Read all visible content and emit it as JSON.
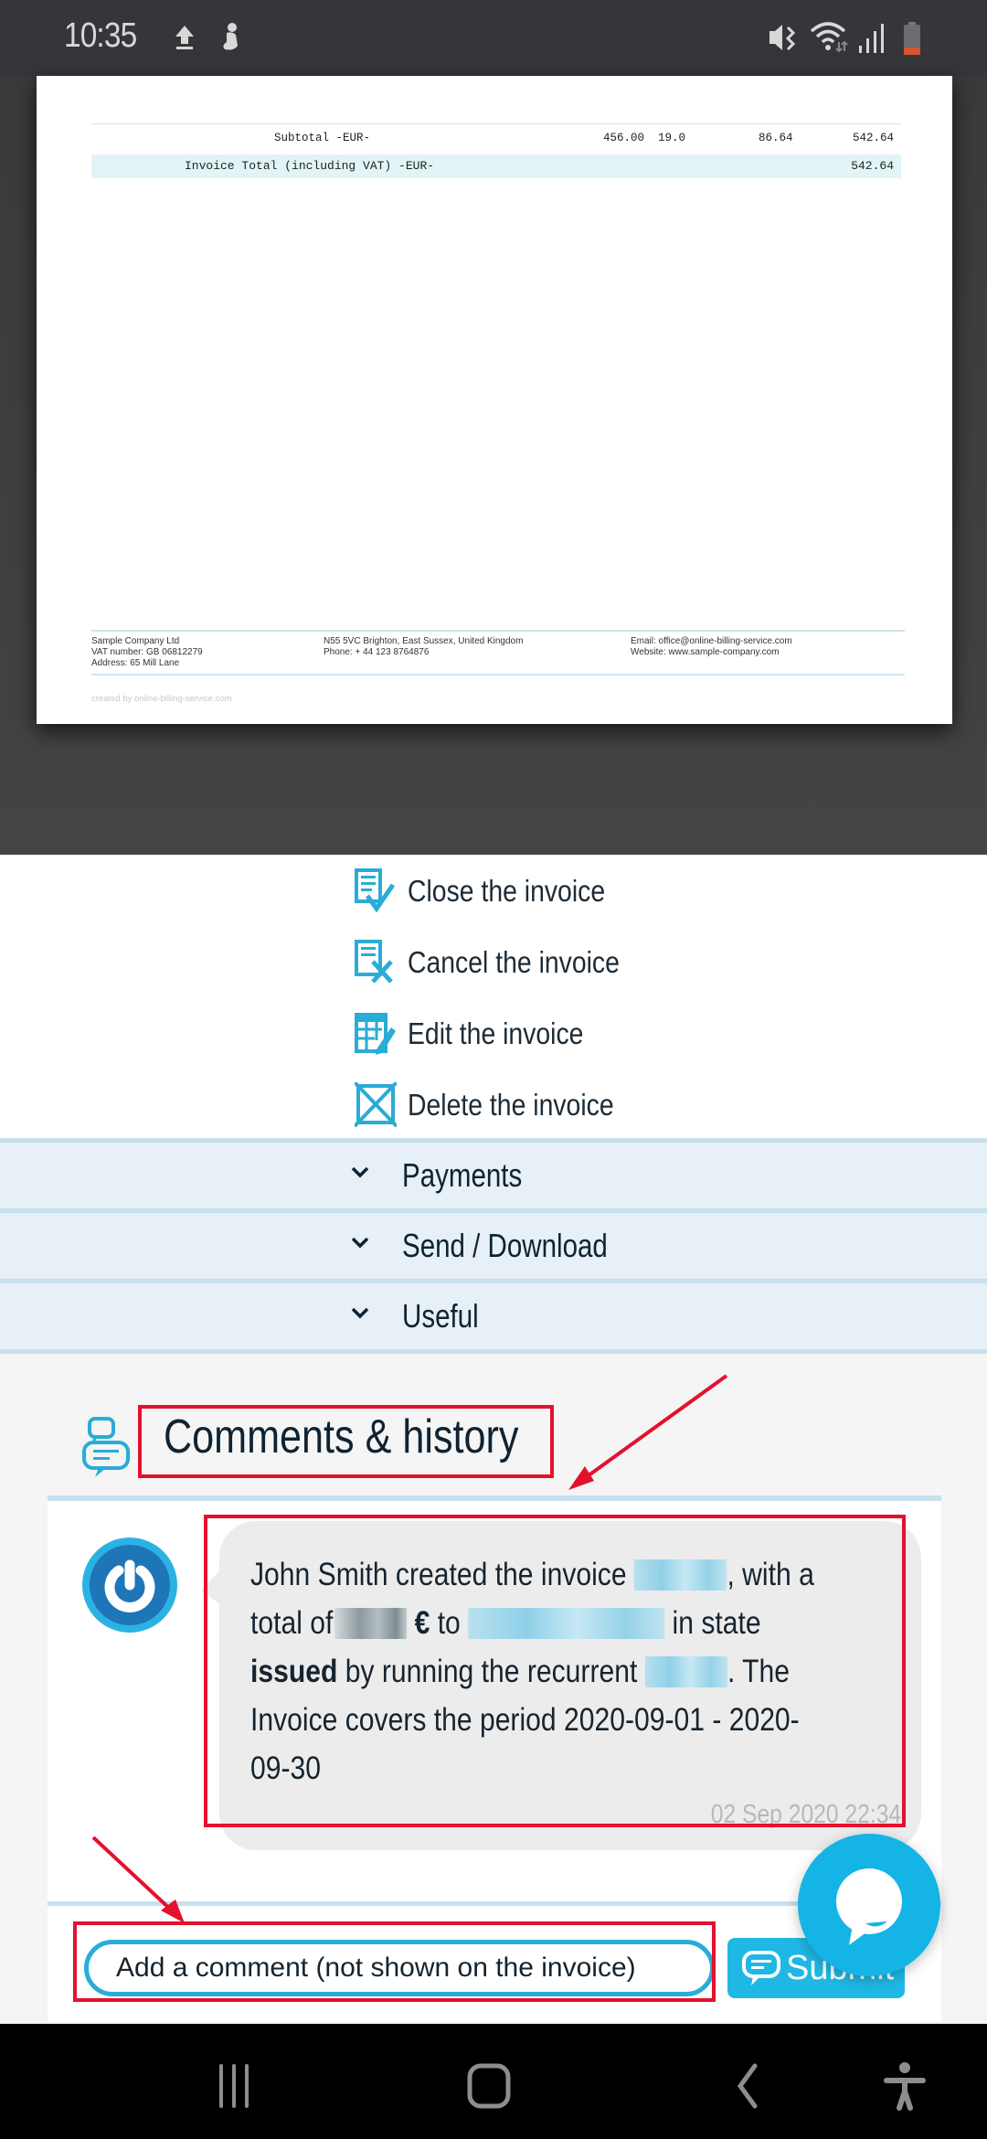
{
  "status_bar": {
    "time": "10:35",
    "left_icons": [
      "upload-icon",
      "app-notification-icon"
    ],
    "right_icons": [
      "vibrate-mute-icon",
      "wifi-icon",
      "signal-icon",
      "battery-low-icon"
    ],
    "battery_level": 0.15
  },
  "document": {
    "subtotal": {
      "label": "Subtotal -EUR-",
      "net": "456.00",
      "vat_rate": "19.0",
      "vat": "86.64",
      "gross": "542.64"
    },
    "total": {
      "label": "Invoice Total (including VAT) -EUR-",
      "value": "542.64"
    },
    "footer": {
      "col1": [
        "Sample Company Ltd",
        "VAT number: GB 06812279",
        "Address: 65 Mill Lane"
      ],
      "col2": [
        "N55 5VC Brighton, East Sussex, United Kingdom",
        "Phone: + 44 123 8764876"
      ],
      "col3": [
        "Email: office@online-billing-service.com",
        "Website: www.sample-company.com"
      ]
    },
    "created_by": "created by online-billing-service.com"
  },
  "actions": [
    {
      "label": "Close the invoice",
      "icon": "invoice-check-icon"
    },
    {
      "label": "Cancel the invoice",
      "icon": "invoice-cancel-icon"
    },
    {
      "label": "Edit the invoice",
      "icon": "invoice-edit-icon"
    },
    {
      "label": "Delete the invoice",
      "icon": "delete-box-icon"
    }
  ],
  "accordions": [
    {
      "label": "Payments"
    },
    {
      "label": "Send / Download"
    },
    {
      "label": "Useful"
    }
  ],
  "comments": {
    "title": "Comments & history",
    "entries": [
      {
        "text_1": "John Smith created the invoice",
        "text_2": ", with a total of",
        "currency": "€",
        "text_3": "to",
        "text_4": "in state",
        "state": "issued",
        "text_5": "by running the recurrent",
        "text_6": ". The Invoice covers the period 2020-09-01 - 2020-09-30",
        "timestamp": "02 Sep 2020 22:34"
      }
    ],
    "input_placeholder": "Add a comment (not shown on the invoice)",
    "submit_label": "Submit"
  },
  "colors": {
    "accent": "#1fb8e4",
    "highlight": "#e4112e",
    "accordion_bg": "#e6f0f6",
    "text_dark": "#0f2332"
  }
}
